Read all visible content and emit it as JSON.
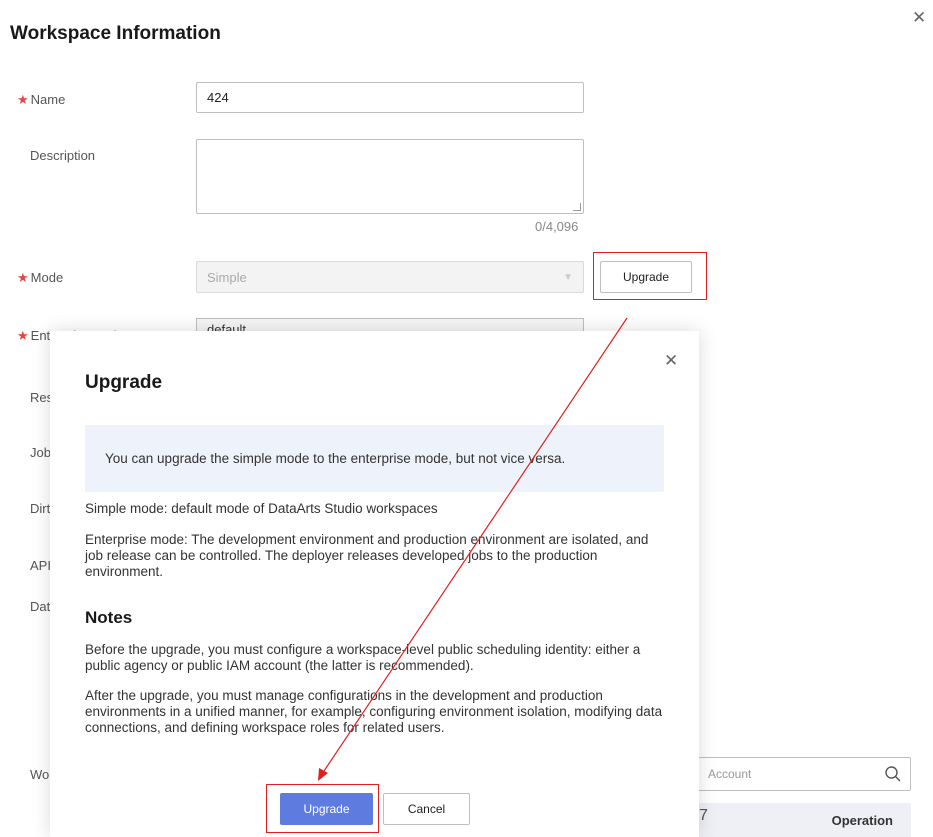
{
  "main": {
    "title": "Workspace Information",
    "fields": {
      "name_label": "Name",
      "name_value": "424",
      "description_label": "Description",
      "description_counter": "0/4,096",
      "mode_label": "Mode",
      "mode_value": "Simple",
      "upgrade_button": "Upgrade",
      "enterprise_project_label": "Enterprise Project",
      "enterprise_project_value": "default"
    },
    "partial_labels": [
      "Res",
      "Job",
      "Dirt",
      "API",
      "Dat",
      "Wo"
    ],
    "search_placeholder": "Account",
    "table_operation_header": "Operation"
  },
  "modal": {
    "title": "Upgrade",
    "info_text": "You can upgrade the simple mode to the enterprise mode, but not vice versa.",
    "simple_mode_text": "Simple mode: default mode of DataArts Studio workspaces",
    "enterprise_mode_text": "Enterprise mode: The development environment and production environment are isolated, and job release can be controlled. The deployer releases developed jobs to the production environment.",
    "notes_title": "Notes",
    "note_1": "Before the upgrade, you must configure a workspace-level public scheduling identity: either a public agency or public IAM account (the latter is recommended).",
    "note_2": "After the upgrade, you must manage configurations in the development and production environments in a unified manner, for example, configuring environment isolation, modifying data connections, and defining workspace roles for related users.",
    "upgrade_button": "Upgrade",
    "cancel_button": "Cancel"
  },
  "colors": {
    "primary": "#5e7ce0",
    "required_star": "#e54545",
    "annotation": "#e02020",
    "info_bg": "#eef2fa"
  }
}
